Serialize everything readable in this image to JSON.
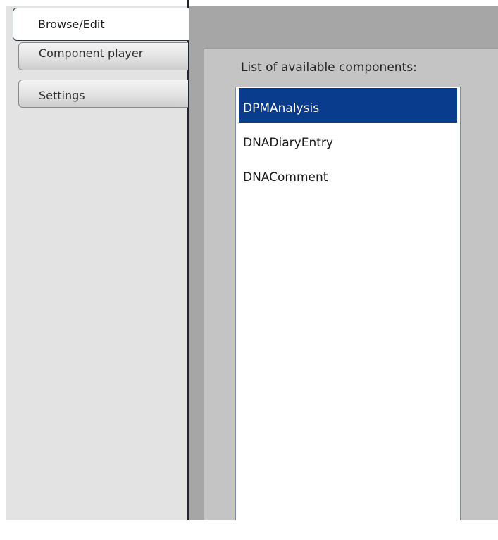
{
  "navigation": {
    "tabs": [
      {
        "label": "Browse/Edit",
        "active": true
      },
      {
        "label": "Component player",
        "active": false
      },
      {
        "label": "Settings",
        "active": false
      }
    ]
  },
  "main": {
    "list_label": "List of available components:",
    "components": [
      "DPMAnalysis",
      "DNADiaryEntry",
      "DNAComment"
    ],
    "selected_component": "DPMAnalysis"
  },
  "colors": {
    "selection": "#0a3c8e",
    "sidebar_background": "#e3e3e3",
    "content_background": "#a6a6a6"
  }
}
